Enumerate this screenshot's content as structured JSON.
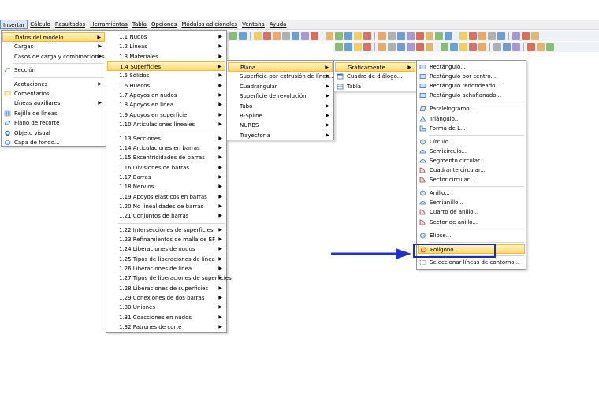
{
  "menubar": [
    {
      "label": "Insertar",
      "active": true
    },
    {
      "label": "Cálculo"
    },
    {
      "label": "Resultados"
    },
    {
      "label": "Herramientas"
    },
    {
      "label": "Tabla"
    },
    {
      "label": "Opciones"
    },
    {
      "label": "Módulos adicionales"
    },
    {
      "label": "Ventana"
    },
    {
      "label": "Ayuda"
    }
  ],
  "menu_insertar": [
    {
      "label": "Datos del modelo",
      "submenu": true,
      "highlight": true
    },
    {
      "label": "Cargas",
      "submenu": true
    },
    {
      "label": "Casos de carga y combinaciones",
      "submenu": true
    },
    {
      "divider": true
    },
    {
      "label": "Sección",
      "icon": "section-icon"
    },
    {
      "divider": true
    },
    {
      "label": "Acotaciones",
      "submenu": true
    },
    {
      "label": "Comentarios...",
      "icon": "comment-icon"
    },
    {
      "label": "Líneas auxiliares",
      "submenu": true
    },
    {
      "label": "Rejilla de líneas",
      "icon": "grid-icon"
    },
    {
      "label": "Plano de recorte",
      "icon": "clipping-plane-icon"
    },
    {
      "label": "Objeto visual",
      "icon": "visual-object-icon"
    },
    {
      "label": "Capa de fondo...",
      "icon": "background-layer-icon"
    }
  ],
  "menu_datos": [
    {
      "label": "1.1 Nudos",
      "submenu": true
    },
    {
      "label": "1.2 Líneas",
      "submenu": true
    },
    {
      "label": "1.3 Materiales",
      "submenu": true
    },
    {
      "label": "1.4 Superficies",
      "submenu": true,
      "highlight": true
    },
    {
      "label": "1.5 Sólidos",
      "submenu": true
    },
    {
      "label": "1.6 Huecos",
      "submenu": true
    },
    {
      "label": "1.7 Apoyos en nudos",
      "submenu": true
    },
    {
      "label": "1.8 Apoyos en línea",
      "submenu": true
    },
    {
      "label": "1.9 Apoyos en superficie",
      "submenu": true
    },
    {
      "label": "1.10 Articulaciones lineales",
      "submenu": true
    },
    {
      "divider": true
    },
    {
      "label": "1.13 Secciones",
      "submenu": true
    },
    {
      "label": "1.14 Articulaciones en barras",
      "submenu": true
    },
    {
      "label": "1.15 Excentricidades de barras",
      "submenu": true
    },
    {
      "label": "1.16 Divisiones de barras",
      "submenu": true
    },
    {
      "label": "1.17 Barras",
      "submenu": true
    },
    {
      "label": "1.18 Nervios",
      "submenu": true
    },
    {
      "label": "1.19 Apoyos elásticos en barras",
      "submenu": true
    },
    {
      "label": "1.20 No linealidades de barras",
      "submenu": true
    },
    {
      "label": "1.21 Conjuntos de barras",
      "submenu": true
    },
    {
      "divider": true
    },
    {
      "label": "1.22 Intersecciones de superficies",
      "submenu": true
    },
    {
      "label": "1.23 Refinamientos de malla de EF",
      "submenu": true
    },
    {
      "label": "1.24 Liberaciones de nudos",
      "submenu": true
    },
    {
      "label": "1.25 Tipos de liberaciones de línea",
      "submenu": true
    },
    {
      "label": "1.26 Liberaciones de línea",
      "submenu": true
    },
    {
      "label": "1.27 Tipos de liberaciones de superficies",
      "submenu": true
    },
    {
      "label": "1.28 Liberaciones de superficies",
      "submenu": true
    },
    {
      "label": "1.29 Conexiones de dos barras",
      "submenu": true
    },
    {
      "label": "1.30 Uniones",
      "submenu": true
    },
    {
      "label": "1.31 Coacciones en nudos",
      "submenu": true
    },
    {
      "label": "1.32 Patrones de corte",
      "submenu": true
    }
  ],
  "menu_superficies": [
    {
      "label": "Plana",
      "submenu": true,
      "highlight": true
    },
    {
      "label": "Superficie por extrusión de línea...",
      "submenu": true
    },
    {
      "label": "Cuadrangular",
      "submenu": true
    },
    {
      "label": "Superficie de revolución",
      "submenu": true
    },
    {
      "label": "Tubo",
      "submenu": true
    },
    {
      "label": "B-Spline",
      "submenu": true
    },
    {
      "label": "NURBS",
      "submenu": true
    },
    {
      "label": "Trayectoria",
      "submenu": true
    }
  ],
  "menu_plana": [
    {
      "label": "Gráficamente",
      "submenu": true,
      "highlight": true
    },
    {
      "label": "Cuadro de diálogo...",
      "icon": "dialog-icon"
    },
    {
      "label": "Tabla",
      "icon": "table-icon"
    }
  ],
  "menu_graficamente": [
    {
      "label": "Rectángulo...",
      "icon": "rectangle-icon"
    },
    {
      "label": "Rectángulo por centro...",
      "icon": "rectangle-center-icon"
    },
    {
      "label": "Rectángulo redondeado...",
      "icon": "rounded-rectangle-icon"
    },
    {
      "label": "Rectángulo achaflanado...",
      "icon": "chamfered-rectangle-icon"
    },
    {
      "divider": true
    },
    {
      "label": "Paralelogramo...",
      "icon": "parallelogram-icon"
    },
    {
      "label": "Triángulo...",
      "icon": "triangle-icon"
    },
    {
      "label": "Forma de L...",
      "icon": "l-shape-icon"
    },
    {
      "divider": true
    },
    {
      "label": "Círculo...",
      "icon": "circle-icon"
    },
    {
      "label": "Semicírculo...",
      "icon": "semicircle-icon"
    },
    {
      "label": "Segmento circular...",
      "icon": "circular-segment-icon"
    },
    {
      "label": "Cuadrante circular...",
      "icon": "circular-quadrant-icon"
    },
    {
      "label": "Sector circular...",
      "icon": "circular-sector-icon"
    },
    {
      "divider": true
    },
    {
      "label": "Anillo...",
      "icon": "ring-icon"
    },
    {
      "label": "Semianillo...",
      "icon": "half-ring-icon"
    },
    {
      "label": "Cuarto de anillo...",
      "icon": "quarter-ring-icon"
    },
    {
      "label": "Sector de anillo...",
      "icon": "ring-sector-icon"
    },
    {
      "divider": true
    },
    {
      "label": "Elipse...",
      "icon": "ellipse-icon"
    },
    {
      "divider": true
    },
    {
      "label": "Polígono...",
      "icon": "polygon-icon",
      "highlight": true
    },
    {
      "divider": true
    },
    {
      "label": "Seleccionar líneas de contorno...",
      "icon": "select-boundary-lines-icon"
    }
  ],
  "colors": {
    "highlight": "#fcd969",
    "arrow": "#1f33c9",
    "box": "#1e2fa8"
  }
}
